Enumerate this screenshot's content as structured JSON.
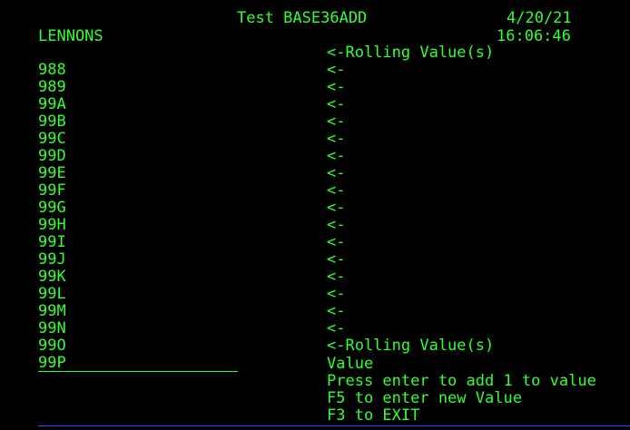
{
  "header": {
    "title": "Test BASE36ADD",
    "date": "4/20/21",
    "user": "LENNONS",
    "time": "16:06:46"
  },
  "values": [
    "988",
    "989",
    "99A",
    "99B",
    "99C",
    "99D",
    "99E",
    "99F",
    "99G",
    "99H",
    "99I",
    "99J",
    "99K",
    "99L",
    "99M",
    "99N",
    "99O"
  ],
  "indicators": {
    "top": "<-Rolling Value(s)",
    "arrow": "<-",
    "bottom": "<-Rolling Value(s)"
  },
  "input": {
    "value": "99P",
    "label": "Value"
  },
  "instructions": [
    "Press enter to add 1 to value",
    "F5 to enter new Value",
    "F3 to EXIT"
  ],
  "colors": {
    "text": "#33ff33",
    "background": "#000000",
    "rule": "#3a4bff"
  }
}
